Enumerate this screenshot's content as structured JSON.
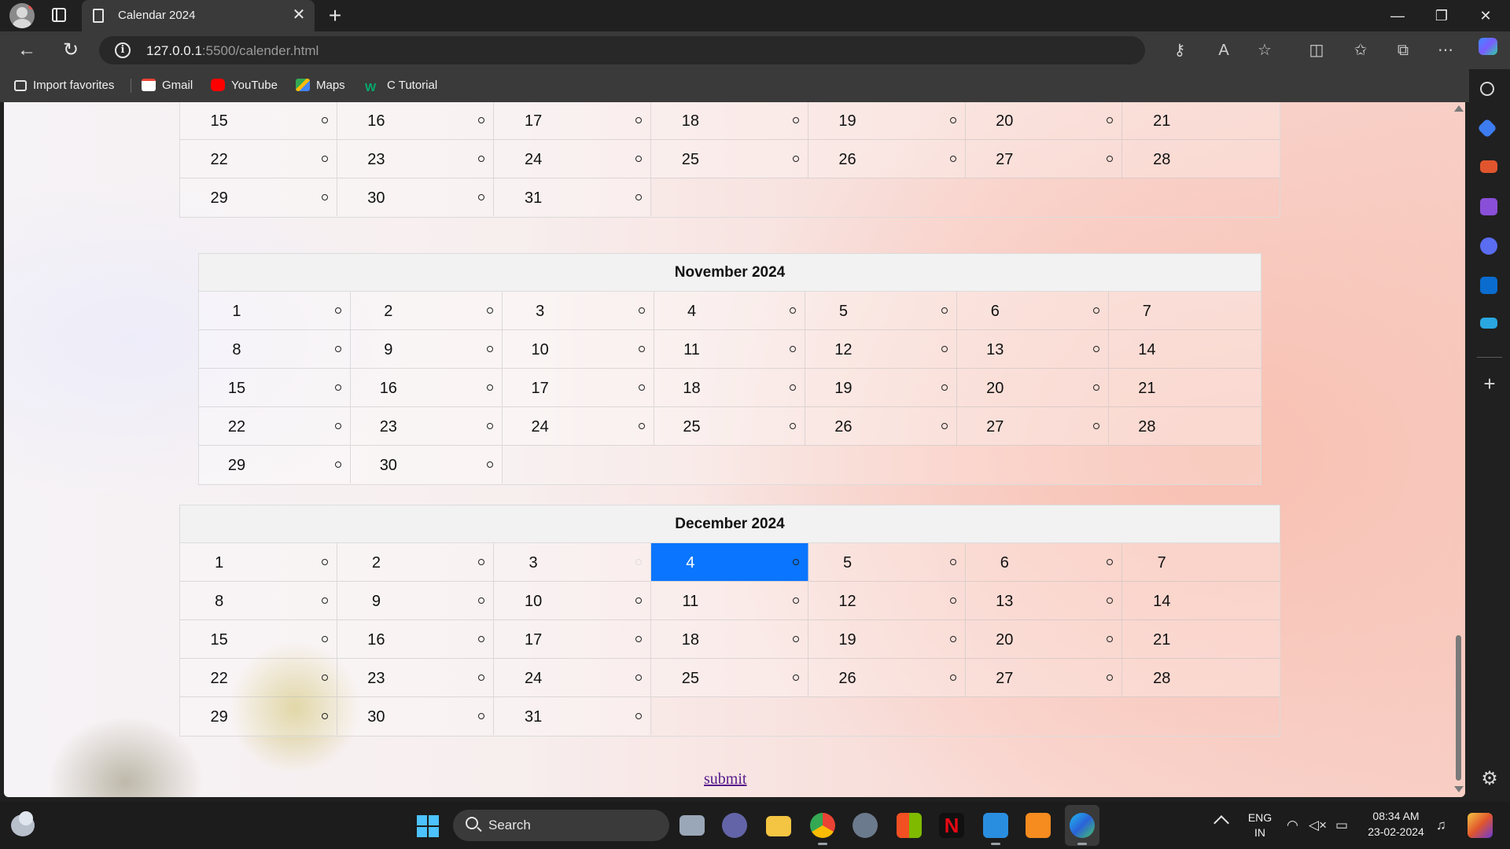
{
  "browser": {
    "tab_title": "Calendar 2024",
    "tab_close": "✕",
    "new_tab": "+",
    "window_controls": [
      "—",
      "❐",
      "✕"
    ],
    "url_host": "127.0.0.1",
    "url_rest": ":5500/calender.html",
    "favorites": [
      {
        "label": "Import favorites",
        "icon": "import-icon",
        "color": "#e6e6e6"
      },
      {
        "label": "Gmail",
        "icon": "gmail-icon",
        "color": "#ea4335"
      },
      {
        "label": "YouTube",
        "icon": "youtube-icon",
        "color": "#ff0000"
      },
      {
        "label": "Maps",
        "icon": "maps-icon",
        "color": "#34a853"
      },
      {
        "label": "C Tutorial",
        "icon": "w-icon",
        "color": "#04aa6d"
      }
    ]
  },
  "calendar": {
    "partial_month": {
      "weeks": [
        [
          "15",
          "16",
          "17",
          "18",
          "19",
          "20",
          "21"
        ],
        [
          "22",
          "23",
          "24",
          "25",
          "26",
          "27",
          "28"
        ],
        [
          "29",
          "30",
          "31"
        ]
      ]
    },
    "november": {
      "title": "November 2024",
      "weeks": [
        [
          "1",
          "2",
          "3",
          "4",
          "5",
          "6",
          "7"
        ],
        [
          "8",
          "9",
          "10",
          "11",
          "12",
          "13",
          "14"
        ],
        [
          "15",
          "16",
          "17",
          "18",
          "19",
          "20",
          "21"
        ],
        [
          "22",
          "23",
          "24",
          "25",
          "26",
          "27",
          "28"
        ],
        [
          "29",
          "30"
        ]
      ]
    },
    "december": {
      "title": "December 2024",
      "selected_day": "4",
      "weeks": [
        [
          "1",
          "2",
          "3",
          "4",
          "5",
          "6",
          "7"
        ],
        [
          "8",
          "9",
          "10",
          "11",
          "12",
          "13",
          "14"
        ],
        [
          "15",
          "16",
          "17",
          "18",
          "19",
          "20",
          "21"
        ],
        [
          "22",
          "23",
          "24",
          "25",
          "26",
          "27",
          "28"
        ],
        [
          "29",
          "30",
          "31"
        ]
      ]
    },
    "submit_label": "submit"
  },
  "taskbar": {
    "search_label": "Search",
    "language_top": "ENG",
    "language_bottom": "IN",
    "time": "08:34 AM",
    "date": "23-02-2024",
    "colors": {
      "accent": "#0a75ff",
      "start": "#4cc2ff"
    }
  }
}
